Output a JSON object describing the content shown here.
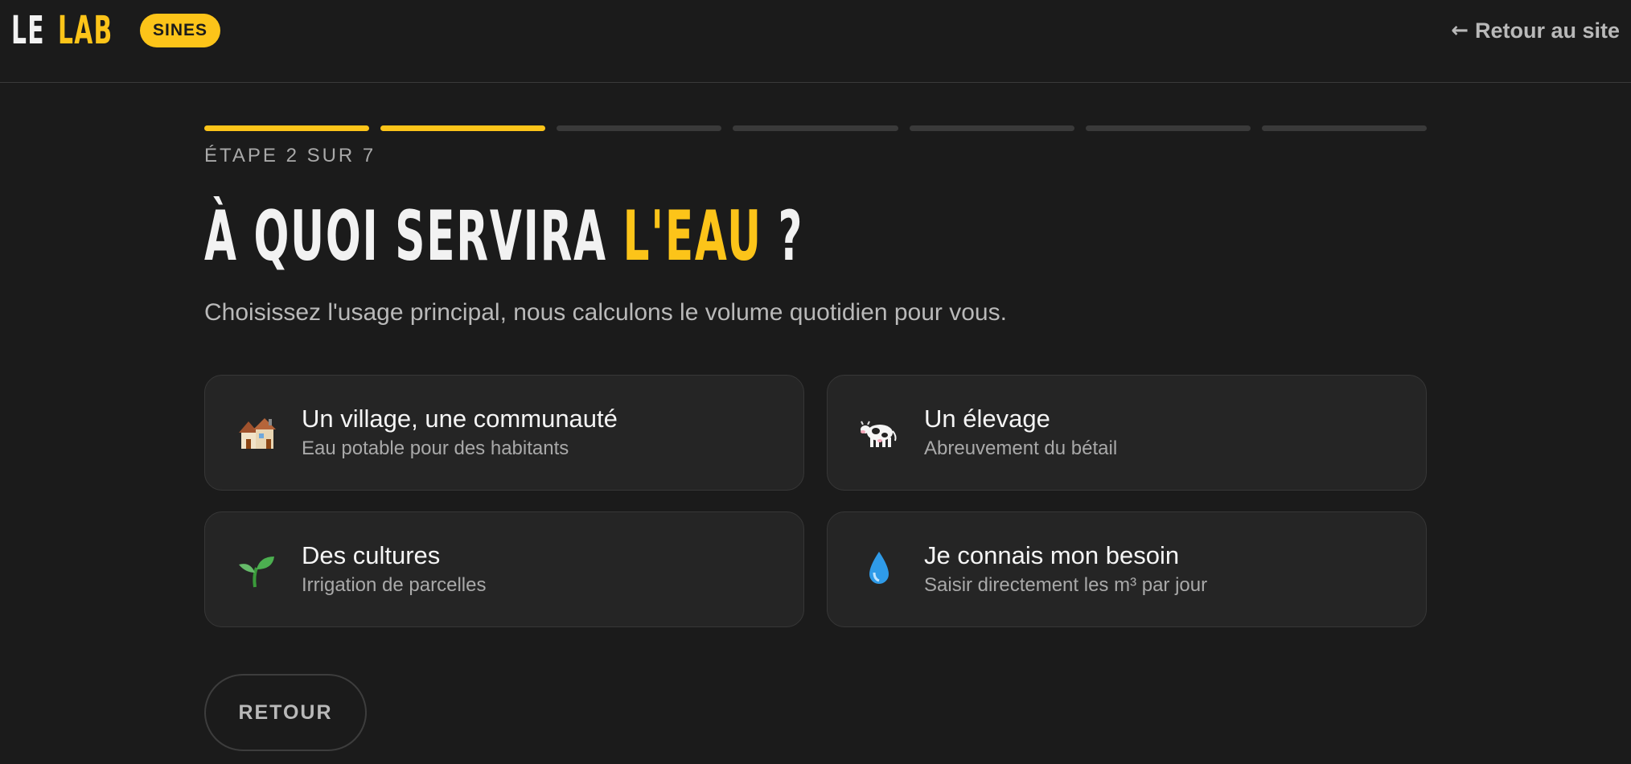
{
  "header": {
    "logo_le": "LE",
    "logo_lab": "LAB",
    "badge": "SINES",
    "back_link": "Retour au site",
    "back_icon": "arrow-left-icon"
  },
  "progress": {
    "current_step": 2,
    "total_steps": 7,
    "label": "ÉTAPE 2 SUR 7"
  },
  "main": {
    "title_part1": "À QUOI SERVIRA ",
    "title_accent": "L'EAU",
    "title_part2": " ?",
    "subtitle": "Choisissez l'usage principal, nous calculons le volume quotidien pour vous."
  },
  "options": [
    {
      "icon": "houses-icon",
      "title": "Un village, une communauté",
      "desc": "Eau potable pour des habitants"
    },
    {
      "icon": "cow-icon",
      "title": "Un élevage",
      "desc": "Abreuvement du bétail"
    },
    {
      "icon": "seedling-icon",
      "title": "Des cultures",
      "desc": "Irrigation de parcelles"
    },
    {
      "icon": "droplet-icon",
      "title": "Je connais mon besoin",
      "desc": "Saisir directement les m³ par jour"
    }
  ],
  "actions": {
    "back_label": "RETOUR"
  },
  "colors": {
    "background": "#1b1b1b",
    "accent": "#fcc419",
    "card": "#252525",
    "muted_text": "#a9a9a9"
  }
}
